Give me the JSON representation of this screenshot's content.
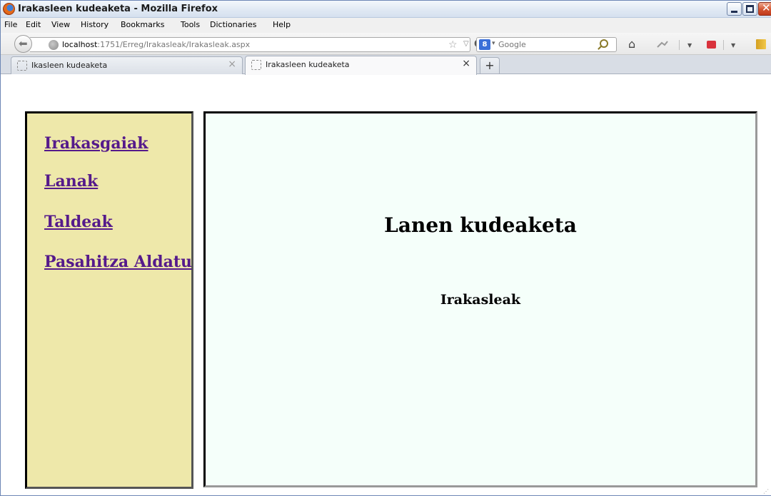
{
  "window": {
    "title": "Irakasleen kudeaketa - Mozilla Firefox"
  },
  "menu": [
    "File",
    "Edit",
    "View",
    "History",
    "Bookmarks",
    "Tools",
    "Dictionaries",
    "Help"
  ],
  "navbar": {
    "url_host": "localhost",
    "url_rest": ":1751/Erreg/Irakasleak/Irakasleak.aspx",
    "search_placeholder": "Google",
    "search_engine_badge": "8"
  },
  "tabs": [
    {
      "label": "Ikasleen kudeaketa",
      "active": false
    },
    {
      "label": "Irakasleen kudeaketa",
      "active": true
    }
  ],
  "newtab_label": "+",
  "sidebar": {
    "links": [
      "Irakasgaiak",
      "Lanak",
      "Taldeak",
      "Pasahitza Aldatu"
    ]
  },
  "main": {
    "heading": "Lanen kudeaketa",
    "subheading": "Irakasleak"
  },
  "colors": {
    "sidebar_bg": "#eee8aa",
    "main_bg": "#f5fffa",
    "link": "#551a8b"
  }
}
